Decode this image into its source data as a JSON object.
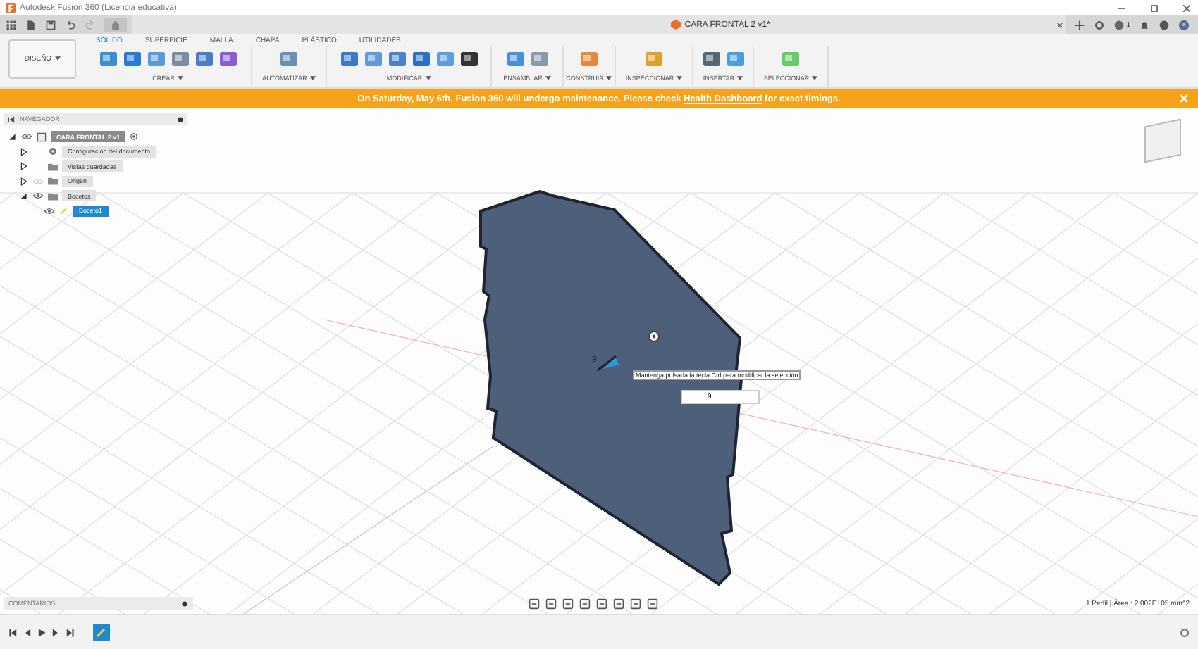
{
  "window": {
    "title": "Autodesk Fusion 360 (Licencia educativa)"
  },
  "document_tab": {
    "title": "CARA FRONTAL 2 v1*"
  },
  "notifications": {
    "count": "1"
  },
  "workspace": {
    "label": "DISEÑO"
  },
  "toolbar_tabs": [
    {
      "label": "SÓLIDO",
      "selected": true
    },
    {
      "label": "SUPERFICIE",
      "selected": false
    },
    {
      "label": "MALLA",
      "selected": false
    },
    {
      "label": "CHAPA",
      "selected": false
    },
    {
      "label": "PLÁSTICO",
      "selected": false
    },
    {
      "label": "UTILIDADES",
      "selected": false
    }
  ],
  "toolbar_groups": [
    {
      "label": "CREAR"
    },
    {
      "label": "AUTOMATIZAR"
    },
    {
      "label": "MODIFICAR"
    },
    {
      "label": "ENSAMBLAR"
    },
    {
      "label": "CONSTRUIR"
    },
    {
      "label": "INSPECCIONAR"
    },
    {
      "label": "INSERTAR"
    },
    {
      "label": "SELECCIONAR"
    }
  ],
  "banner": {
    "before": "On Saturday, May 6th, Fusion 360 will undergo maintenance. Please check",
    "link": "Health Dashboard",
    "after": "for exact timings."
  },
  "browser": {
    "title": "NAVEGADOR",
    "items": [
      {
        "label": "CARA FRONTAL 2 v1",
        "kind": "root",
        "expanded": true,
        "visible": true,
        "selected": false,
        "children": [
          {
            "label": "Configuración del documento",
            "kind": "settings",
            "expanded": false,
            "selected": false
          },
          {
            "label": "Vistas guardadas",
            "kind": "folder",
            "expanded": false,
            "selected": false
          },
          {
            "label": "Origen",
            "kind": "folder",
            "expanded": false,
            "visible": false,
            "selected": false
          },
          {
            "label": "Bocetos",
            "kind": "folder",
            "expanded": true,
            "visible": true,
            "selected": false,
            "children": [
              {
                "label": "Boceto1",
                "kind": "sketch",
                "visible": true,
                "selected": true
              }
            ]
          }
        ]
      }
    ]
  },
  "viewport": {
    "tooltip": "Mantenga pulsada la tecla Ctrl para modificar la selección",
    "distance_field": {
      "value": "9"
    },
    "distance_label": "9",
    "status": "1 Perfil | Área : 2.002E+05 mm^2"
  },
  "comments": {
    "title": "COMENTARIOS"
  }
}
